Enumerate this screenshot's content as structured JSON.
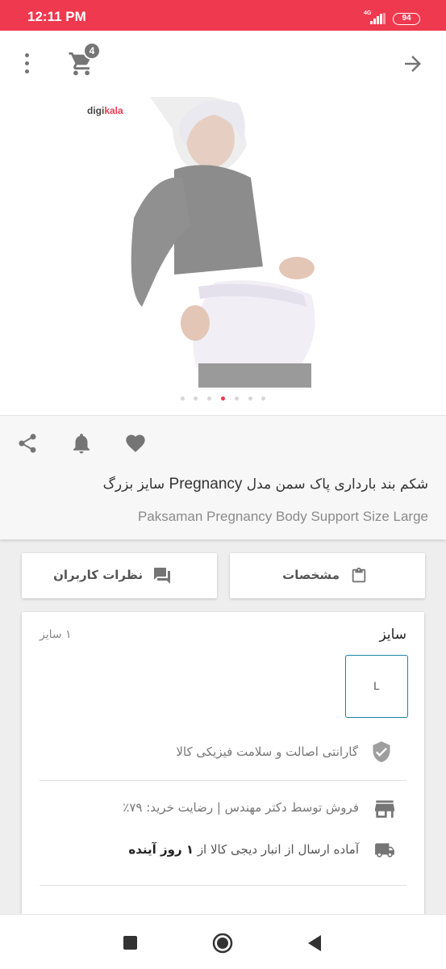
{
  "status_bar": {
    "time": "12:11 PM",
    "network": "4G",
    "battery": "94"
  },
  "toolbar": {
    "cart_count": "4",
    "icons": [
      "more-vert-icon",
      "cart-icon",
      "arrow-forward-icon"
    ]
  },
  "gallery": {
    "brand_logo": [
      "digi",
      "kala"
    ],
    "dot_count": 7,
    "active_dot": 3
  },
  "product": {
    "title_fa_pre": "شکم بند بارداری پاک سمن مدل",
    "title_fa_en": "Pregnancy",
    "title_fa_post": "سایز بزرگ",
    "title_en": "Paksaman Pregnancy Body Support Size Large",
    "icons": [
      "share-icon",
      "bell-icon",
      "heart-icon"
    ]
  },
  "buttons": {
    "specs_label": "مشخصات",
    "reviews_label": "نظرات کاربران"
  },
  "size_section": {
    "title": "سایز",
    "count": "۱ سایز",
    "options": [
      "L"
    ]
  },
  "info": {
    "guarantee": "گارانتی اصالت و سلامت فیزیکی کالا",
    "seller": "فروش توسط دکتر مهندس | رضایت خرید: ۷۹٪",
    "shipping_pre": "آماده ارسال از انبار دیجی کالا از",
    "shipping_days": "۱ روز آینده"
  },
  "colors": {
    "accent": "#ef394e",
    "icon_gray": "#757575",
    "size_border": "#1b84a8"
  }
}
